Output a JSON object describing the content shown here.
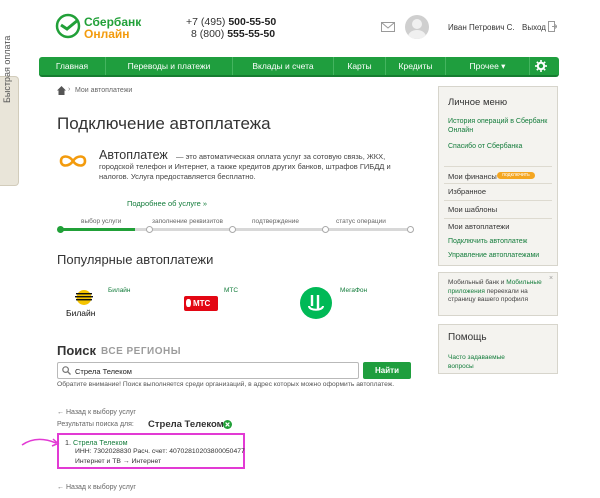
{
  "header": {
    "logo_title": "Сбербанк",
    "logo_sub": "Онлайн",
    "phone1_prefix": "+7 (495)",
    "phone1_num": "500-55-50",
    "phone2_prefix": "8 (800)",
    "phone2_num": "555-55-50",
    "user_name": "Иван Петрович С.",
    "logout": "Выход"
  },
  "quick_tab": "Быстрая оплата",
  "nav": {
    "items": [
      "Главная",
      "Переводы и платежи",
      "Вклады и счета",
      "Карты",
      "Кредиты",
      "Прочее ▾"
    ]
  },
  "breadcrumb": "Мои автоплатежи",
  "page_title": "Подключение автоплатежа",
  "intro": {
    "title": "Автоплатеж",
    "text": "— это автоматическая оплата услуг за сотовую связь, ЖКХ, городской телефон и Интернет, а также кредитов других банков, штрафов ГИБДД и налогов. Услуга предоставляется бесплатно.",
    "more_link": "Подробнее об услуге »"
  },
  "steps": [
    "выбор услуги",
    "заполнение реквизитов",
    "подтверждение",
    "статус операции"
  ],
  "popular": {
    "title": "Популярные автоплатежи",
    "providers": [
      {
        "name": "Билайн",
        "logo_text": "Билайн"
      },
      {
        "name": "МТС",
        "logo_text": "МТС"
      },
      {
        "name": "МегаФон",
        "logo_text": ""
      }
    ]
  },
  "search": {
    "title": "Поиск",
    "region": "ВСЕ РЕГИОНЫ",
    "value": "Стрела Телеком",
    "button": "Найти",
    "note": "Обратите внимание! Поиск выполняется среди организаций, в адрес которых можно оформить автоплатеж."
  },
  "results": {
    "back_label": "← Назад к выбору услуг",
    "label": "Результаты поиска для:",
    "query": "Стрела Телеком",
    "item": {
      "name": "Стрела Телеком",
      "index": "1.",
      "inn": "ИНН: 7302028830 Расч. счет: 40702810203800050477",
      "category": "Интернет и ТВ",
      "subcategory": "Интернет"
    }
  },
  "right_panel": {
    "menu_title": "Личное меню",
    "history_link": "История операций в Сбербанк Онлайн",
    "thanks_link": "Спасибо от Сбербанка",
    "finances": "Мои финансы",
    "finances_badge": "подключить",
    "favorites": "Избранное",
    "templates": "Мои шаблоны",
    "autopays": "Мои автоплатежи",
    "autopay_connect": "Подключить автоплатеж",
    "autopay_manage": "Управление автоплатежами",
    "mobile_note_a": "Мобильный банк и ",
    "mobile_note_link": "Мобильные приложения",
    "mobile_note_b": " переехали на страницу вашего профиля",
    "help_title": "Помощь",
    "faq_link": "Часто задаваемые вопросы"
  },
  "colors": {
    "brand_green": "#21a038",
    "nav_green": "#1f9e3e",
    "logo_orange": "#f39b0d",
    "highlight_magenta": "#e23ad4"
  }
}
